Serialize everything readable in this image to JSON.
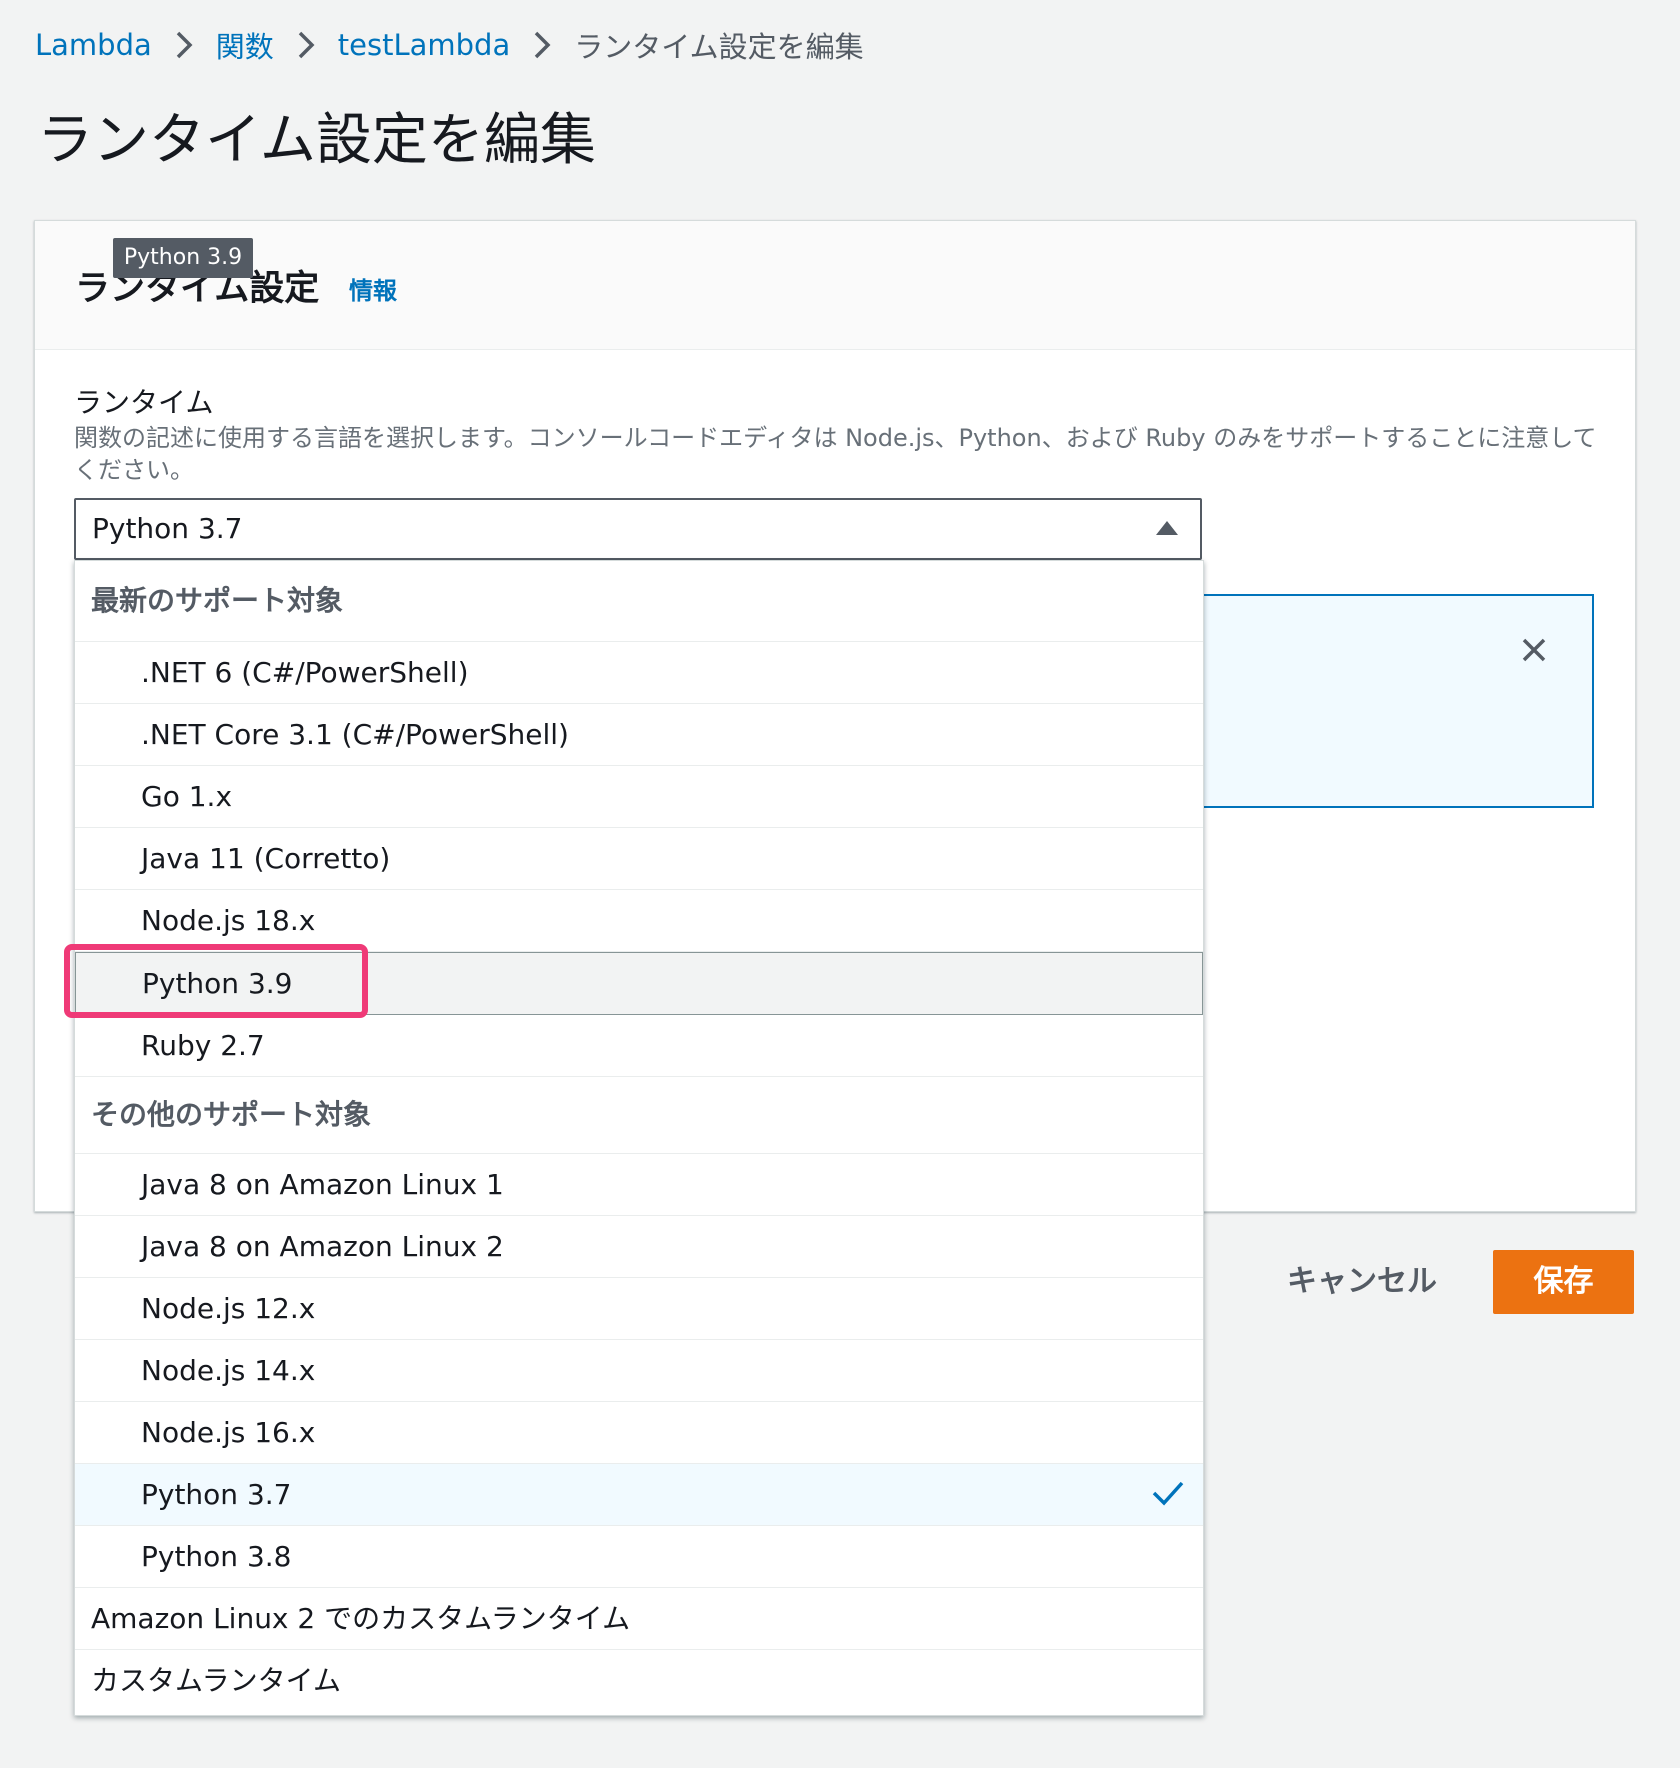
{
  "breadcrumb": {
    "items": [
      "Lambda",
      "関数",
      "testLambda"
    ],
    "current": "ランタイム設定を編集"
  },
  "page": {
    "title": "ランタイム設定を編集"
  },
  "panel": {
    "title": "ランタイム設定",
    "info_link": "情報",
    "tooltip": "Python 3.9"
  },
  "runtime_field": {
    "label": "ランタイム",
    "description": "関数の記述に使用する言語を選択します。コンソールコードエディタは Node.js、Python、および Ruby のみをサポートすることに注意してください。",
    "selected_value": "Python 3.7"
  },
  "dropdown": {
    "group_latest": "最新のサポート対象",
    "latest_options": [
      ".NET 6 (C#/PowerShell)",
      ".NET Core 3.1 (C#/PowerShell)",
      "Go 1.x",
      "Java 11 (Corretto)",
      "Node.js 18.x",
      "Python 3.9",
      "Ruby 2.7"
    ],
    "group_other": "その他のサポート対象",
    "other_options": [
      "Java 8 on Amazon Linux 1",
      "Java 8 on Amazon Linux 2",
      "Node.js 12.x",
      "Node.js 14.x",
      "Node.js 16.x",
      "Python 3.7",
      "Python 3.8"
    ],
    "custom_options": [
      "Amazon Linux 2 でのカスタムランタイム",
      "カスタムランタイム"
    ],
    "hovered": "Python 3.9",
    "selected": "Python 3.7"
  },
  "actions": {
    "cancel": "キャンセル",
    "save": "保存"
  },
  "colors": {
    "accent": "#ec7211",
    "link": "#0073bb",
    "highlight": "#ef3a77",
    "selected_bg": "#f1faff"
  },
  "icons": {
    "breadcrumb_separator": "chevron-right-icon",
    "select_caret": "caret-up-icon",
    "alert_close": "close-icon",
    "selected_check": "check-icon"
  }
}
